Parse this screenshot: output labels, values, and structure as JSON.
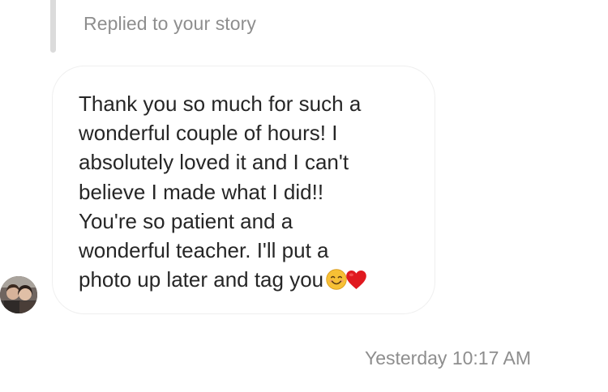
{
  "story_reply": {
    "label": "Replied to your story"
  },
  "message": {
    "text": "Thank you so much for such a\nwonderful couple of hours! I\nabsolutely loved it and I can't\nbelieve I made what I did!!\nYou're so patient and a\nwonderful teacher. I'll put a\nphoto up later and tag you",
    "emojis": [
      "smiling-face-icon",
      "red-heart-icon"
    ]
  },
  "timestamp": "Yesterday 10:17 AM",
  "colors": {
    "muted_text": "#8e8e8e",
    "body_text": "#262626",
    "bubble_border": "#efefef",
    "reply_bar": "#dbdbdb",
    "heart": "#e0191f",
    "smile": "#f7c035"
  }
}
